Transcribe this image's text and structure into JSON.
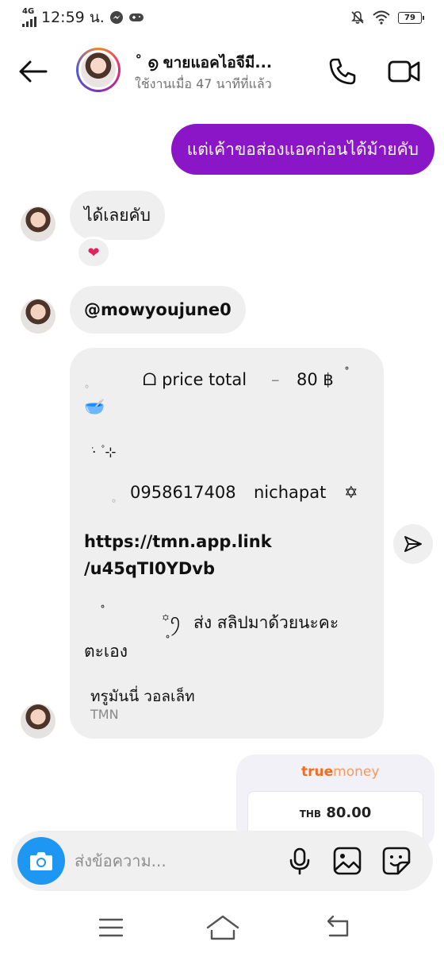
{
  "status_bar": {
    "network": "4G",
    "time": "12:59 น.",
    "battery": "79",
    "icons": [
      "signal-icon",
      "messenger-icon",
      "game-controller-icon",
      "mute-icon",
      "wifi-icon",
      "battery-icon"
    ]
  },
  "header": {
    "name": "˚ ൭ ขายแอคไอจีมี...",
    "status": "ใช้งานเมื่อ 47 นาทีที่แล้ว"
  },
  "messages": {
    "sent_1": "แต่เค้าขอส่องแอคก่อนได้ม้ายคับ",
    "recv_1": "ได้เลยคับ",
    "reaction": "❤",
    "recv_mention": "@mowyoujune0",
    "payment": {
      "dot_1": "◦",
      "price_line": "ᗝ price total",
      "dash": "–",
      "amount": "80 ฿",
      "deg_1": "˚",
      "bowl": "🥣",
      "deco": "·ֹ ۫ ⊹",
      "dot_2": "◦",
      "phone": "0958617408",
      "holder": "nichapat",
      "star": "✡",
      "link_1": "https://tmn.app.link",
      "link_2": "/u45qTI0YDvb",
      "deg_2": "˚",
      "ornament": "꙳ꪆ",
      "slip_text_1": "ส่ง สลิปมาด้วยนะคะ",
      "slip_text_2": "ตะเอง",
      "deg_3": "˚",
      "wallet_name": "ทรูมันนี่ วอลเล็ท",
      "wallet_sub": "TMN"
    },
    "truemoney": {
      "logo_bold": "true",
      "logo_light": "money",
      "currency": "THB",
      "amount": "80.00"
    }
  },
  "composer": {
    "placeholder": "ส่งข้อความ..."
  },
  "colors": {
    "sent_bubble": "#8a16c8",
    "received_bubble": "#efefef",
    "camera_button": "#1e97f3",
    "truemoney_orange": "#f26c23"
  }
}
